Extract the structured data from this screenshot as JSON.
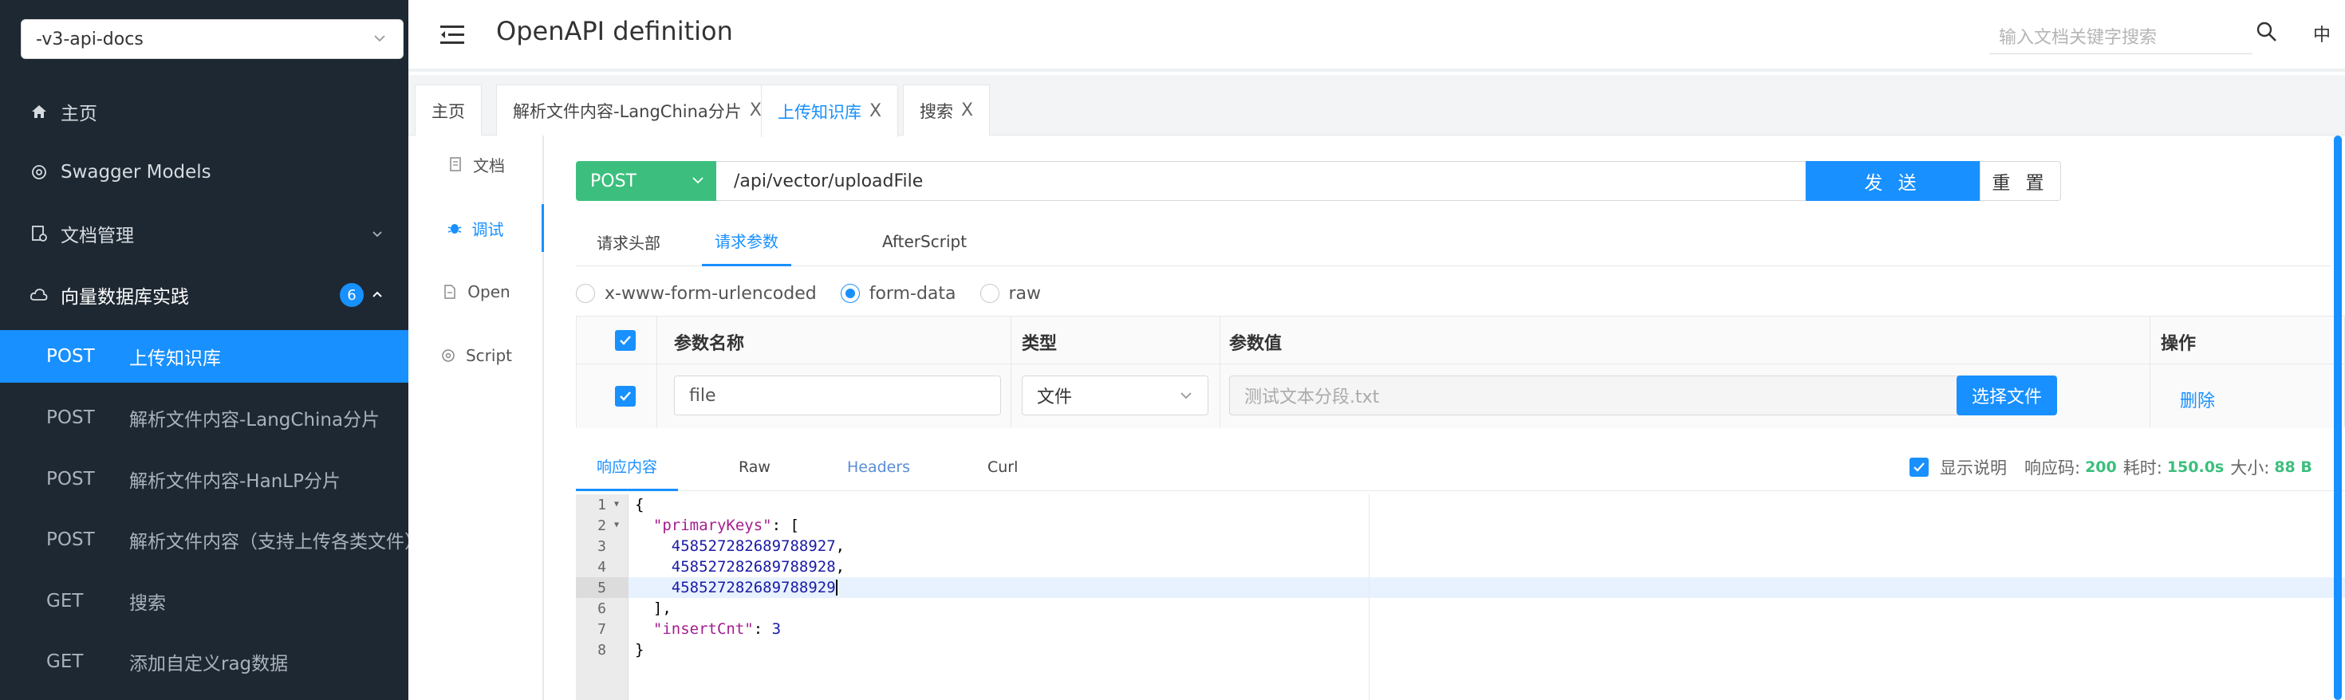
{
  "sidebar": {
    "group_select": "-v3-api-docs",
    "menu": [
      {
        "label": "主页",
        "icon": "home-icon"
      },
      {
        "label": "Swagger Models",
        "icon": "models-icon"
      },
      {
        "label": "文档管理",
        "icon": "doc-manage-icon"
      },
      {
        "label": "向量数据库实践",
        "icon": "cloud-icon",
        "badge": "6"
      }
    ],
    "apis": [
      {
        "method": "POST",
        "title": "上传知识库",
        "active": true
      },
      {
        "method": "POST",
        "title": "解析文件内容-LangChina分片"
      },
      {
        "method": "POST",
        "title": "解析文件内容-HanLP分片"
      },
      {
        "method": "POST",
        "title": "解析文件内容（支持上传各类文件）"
      },
      {
        "method": "GET",
        "title": "搜索"
      },
      {
        "method": "GET",
        "title": "添加自定义rag数据"
      }
    ]
  },
  "header": {
    "title": "OpenAPI definition",
    "search_placeholder": "输入文档关键字搜索",
    "lang": "中"
  },
  "tabs": [
    {
      "label": "主页",
      "closable": false
    },
    {
      "label": "解析文件内容-LangChina分片",
      "closable": true
    },
    {
      "label": "上传知识库",
      "closable": true,
      "active": true
    },
    {
      "label": "搜索",
      "closable": true
    }
  ],
  "tab_close": "X",
  "subnav": [
    {
      "label": "文档",
      "icon": "document-icon"
    },
    {
      "label": "调试",
      "icon": "bug-icon",
      "active": true
    },
    {
      "label": "Open",
      "icon": "file-icon"
    },
    {
      "label": "Script",
      "icon": "script-icon"
    }
  ],
  "request": {
    "method": "POST",
    "url": "/api/vector/uploadFile",
    "send_label": "发 送",
    "reset_label": "重 置",
    "tabs": [
      "请求头部",
      "请求参数",
      "AfterScript"
    ],
    "active_tab": "请求参数",
    "content_types": [
      "x-www-form-urlencoded",
      "form-data",
      "raw"
    ],
    "selected_content_type": "form-data"
  },
  "params_table": {
    "headers": {
      "name": "参数名称",
      "type": "类型",
      "value": "参数值",
      "action": "操作"
    },
    "rows": [
      {
        "checked": true,
        "name": "file",
        "type": "文件",
        "value_placeholder": "测试文本分段.txt",
        "choose_label": "选择文件",
        "delete_label": "删除"
      }
    ]
  },
  "response": {
    "tabs": [
      "响应内容",
      "Raw",
      "Headers",
      "Curl"
    ],
    "active_tab": "响应内容",
    "show_desc_label": "显示说明",
    "code_label": "响应码:",
    "code": "200",
    "time_label": "耗时:",
    "time": "150.0s",
    "size_label": "大小:",
    "size": "88 B",
    "line_numbers": [
      "1",
      "2",
      "3",
      "4",
      "5",
      "6",
      "7",
      "8"
    ],
    "body": {
      "l1": "{",
      "l2_key": "\"primaryKeys\"",
      "l2_rest": ": [",
      "l3": "458527282689788927",
      "l4": "458527282689788928",
      "l5": "458527282689788929",
      "l6": "],",
      "l7_key": "\"insertCnt\"",
      "l7_val": "3",
      "l8": "}"
    }
  },
  "colors": {
    "sidebar_bg": "#1e2832",
    "accent": "#1890ff",
    "method_post": "#3cbf7e"
  }
}
